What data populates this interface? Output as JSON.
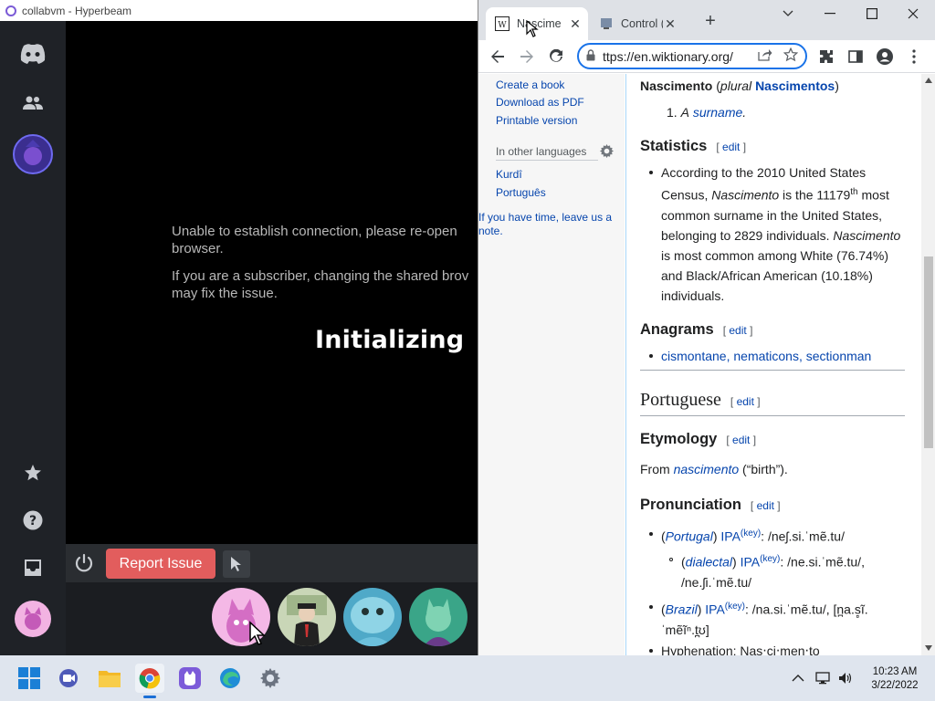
{
  "hyperbeam": {
    "window_title": "collabvm - Hyperbeam",
    "message_line1": "Unable to establish connection, please re-open",
    "message_line1b": "browser.",
    "message_line2": "If you are a subscriber, changing the shared brov",
    "message_line2b": "may fix the issue.",
    "status": "Initializing",
    "report_button": "Report Issue",
    "sidebar_icons": [
      "discord-icon",
      "people-icon",
      "room-avatar",
      "star-icon",
      "help-icon",
      "inbox-icon",
      "user-avatar"
    ],
    "participants": [
      "pink-cat-avatar",
      "suit-character-avatar",
      "blue-blob-avatar",
      "green-cat-avatar"
    ],
    "accent_color": "#e25d5d"
  },
  "chrome": {
    "tabs": [
      {
        "label": "Nascime",
        "icon": "wiktionary-favicon"
      },
      {
        "label": "Control (",
        "icon": "control-favicon"
      }
    ],
    "url": "ttps://en.wiktionary.org/",
    "window_controls": [
      "chevron-down-icon",
      "minimize-icon",
      "maximize-icon",
      "close-icon"
    ]
  },
  "wiki_sidebar": {
    "links": [
      "Create a book",
      "Download as PDF",
      "Printable version"
    ],
    "languages_heading": "In other languages",
    "languages": [
      "Kurdî",
      "Português"
    ],
    "note_link": "If you have time, leave us a note."
  },
  "wiki": {
    "entry_word": "Nascimento",
    "plural_label": "plural",
    "plural_word": "Nascimentos",
    "def_num": "1.",
    "def_a": "A",
    "def_surname": "surname",
    "statistics_heading": "Statistics",
    "edit": "edit",
    "stats_text": {
      "l1": "According to the 2010 United States",
      "l2a": "Census, ",
      "l2b": "Nascimento",
      "l2c": " is the 11179",
      "l2sup": "th",
      "l2d": " most",
      "l3": "common surname in the United States,",
      "l4a": "belonging to 2829 individuals. ",
      "l4b": "Nascimento",
      "l5": "is most common among White (76.74%)",
      "l6": "and Black/African American (10.18%)",
      "l7": "individuals."
    },
    "anagrams_heading": "Anagrams",
    "anagrams": "cismontane, nematicons, sectionman",
    "language_heading": "Portuguese",
    "etymology_heading": "Etymology",
    "etymology_from": "From",
    "etymology_word": "nascimento",
    "etymology_gloss": "(“birth”).",
    "pronunciation_heading": "Pronunciation",
    "pron": {
      "p1_region": "Portugal",
      "p1_ipa": "/neʃ.si.ˈmẽ.tu/",
      "p2_region": "dialectal",
      "p2_ipa": "/ne.si.ˈmẽ.tu/,",
      "p2_ipa2": "/ne.ʃi.ˈmẽ.tu/",
      "p3_region": "Brazil",
      "p3_ipa": "/na.si.ˈmẽ.tu/, [n̪a.s̻ĩ.",
      "p3_ipa2": "ˈmẽĩⁿ.t̪ʊ]",
      "ipa_label": "IPA",
      "key_label": "(key)",
      "hyphenation": "Hyphenation: Nas‧ci‧men‧to"
    }
  },
  "taskbar": {
    "apps": [
      "windows-start-icon",
      "meet-icon",
      "file-explorer-icon",
      "chrome-icon",
      "hyperbeam-icon",
      "edge-icon",
      "settings-icon"
    ],
    "time": "10:23 AM",
    "date": "3/22/2022"
  }
}
